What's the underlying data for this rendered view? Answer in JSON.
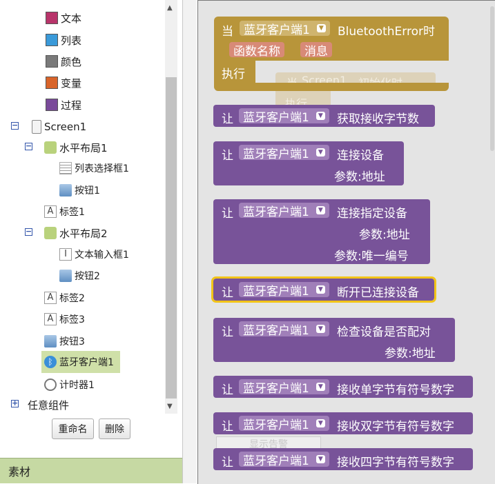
{
  "tree": {
    "items": [
      {
        "label": "文本",
        "icon": "text-block-icon",
        "color": "#b8346a"
      },
      {
        "label": "列表",
        "icon": "list-block-icon",
        "color": "#3a9ad9"
      },
      {
        "label": "颜色",
        "icon": "color-block-icon",
        "color": "#7a7a7a"
      },
      {
        "label": "变量",
        "icon": "variable-block-icon",
        "color": "#d8642a"
      },
      {
        "label": "过程",
        "icon": "procedure-block-icon",
        "color": "#7a4a9a"
      },
      {
        "label": "Screen1",
        "icon": "screen-icon"
      },
      {
        "label": "水平布局1",
        "icon": "horizontal-layout-icon"
      },
      {
        "label": "列表选择框1",
        "icon": "listpicker-icon"
      },
      {
        "label": "按钮1",
        "icon": "button-icon"
      },
      {
        "label": "标签1",
        "icon": "label-icon"
      },
      {
        "label": "水平布局2",
        "icon": "horizontal-layout-icon"
      },
      {
        "label": "文本输入框1",
        "icon": "textbox-icon"
      },
      {
        "label": "按钮2",
        "icon": "button-icon"
      },
      {
        "label": "标签2",
        "icon": "label-icon"
      },
      {
        "label": "标签3",
        "icon": "label-icon"
      },
      {
        "label": "按钮3",
        "icon": "button-icon"
      },
      {
        "label": "蓝牙客户端1",
        "icon": "bluetooth-icon"
      },
      {
        "label": "计时器1",
        "icon": "clock-icon"
      },
      {
        "label": "任意组件",
        "icon": "expand-icon"
      }
    ]
  },
  "buttons": {
    "rename": "重命名",
    "delete": "删除"
  },
  "assets_label": "素材",
  "blocks": {
    "event": {
      "when": "当",
      "component": "蓝牙客户端1",
      "event": "BluetoothError时",
      "params": [
        "函数名称",
        "消息"
      ],
      "do": "执行"
    },
    "ghost": {
      "when": "当",
      "component": "Screen1",
      "event": "初始化时",
      "do": "执行"
    },
    "ghost_button": "显示告警",
    "let": "让",
    "calls": [
      {
        "method": "获取接收字节数",
        "params": []
      },
      {
        "method": "连接设备",
        "params": [
          "参数:地址"
        ]
      },
      {
        "method": "连接指定设备",
        "params": [
          "参数:地址",
          "参数:唯一编号"
        ]
      },
      {
        "method": "断开已连接设备",
        "params": []
      },
      {
        "method": "检查设备是否配对",
        "params": [
          "参数:地址"
        ]
      },
      {
        "method": "接收单字节有符号数字",
        "params": []
      },
      {
        "method": "接收双字节有符号数字",
        "params": []
      },
      {
        "method": "接收四字节有符号数字",
        "params": []
      }
    ]
  }
}
